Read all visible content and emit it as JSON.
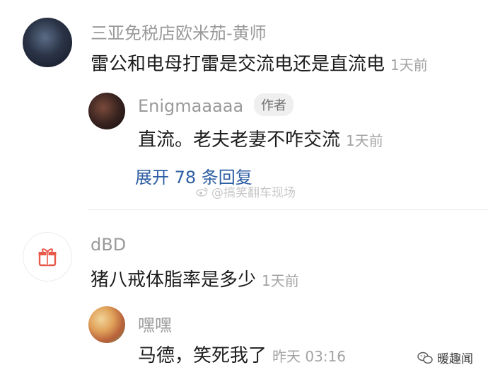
{
  "comments": [
    {
      "user": "三亚免税店欧米茄-黄师",
      "text": "雷公和电母打雷是交流电还是直流电",
      "time": "1天前",
      "reply": {
        "user": "Enigmaaaaa",
        "badge": "作者",
        "text": "直流。老夫老妻不咋交流",
        "time": "1天前"
      },
      "expand_label": "展开 78 条回复"
    },
    {
      "user": "dBD",
      "text": "猪八戒体脂率是多少",
      "time": "1天前",
      "reply": {
        "user": "嘿嘿",
        "text": "马德，笑死我了",
        "time": "昨天 03:16"
      }
    }
  ],
  "watermark": "@搞笑翻车现场",
  "corner_brand": "暖趣闻",
  "icons": {
    "gift": "gift-icon",
    "weibo": "weibo-icon",
    "wechat": "wechat-icon"
  },
  "colors": {
    "name": "#9a9a9a",
    "text": "#1c1c1c",
    "link": "#2d5ea3",
    "gift": "#e8594a"
  }
}
